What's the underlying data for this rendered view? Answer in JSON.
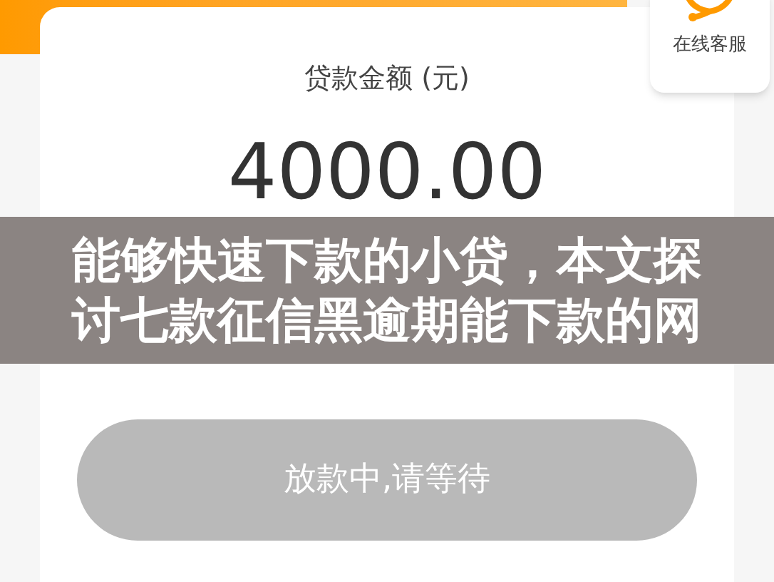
{
  "support": {
    "label": "在线客服"
  },
  "loan": {
    "label": "贷款金额 (元)",
    "amount": "4000.00"
  },
  "action_button": {
    "label": "放款中,请等待",
    "disabled": true
  },
  "caption": {
    "text": "能够快速下款的小贷，本文探讨七款征信黑逾期能下款的网"
  }
}
